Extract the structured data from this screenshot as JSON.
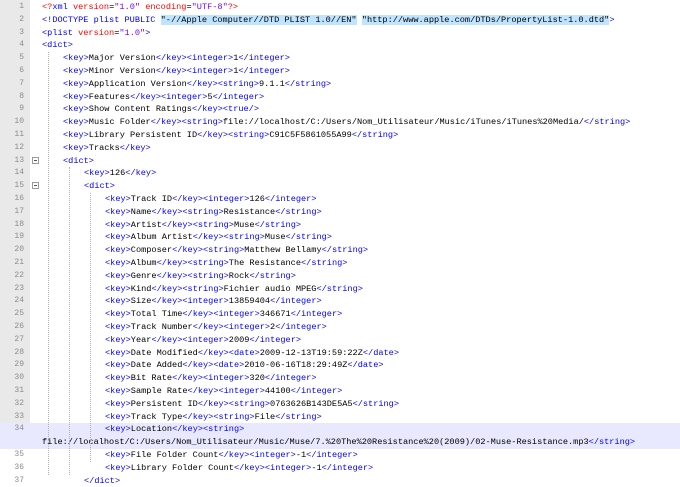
{
  "editor": {
    "lines": [
      {
        "n": "1",
        "parts": [
          [
            "pi",
            "<?"
          ],
          [
            "t",
            "xml"
          ],
          [
            "a",
            " version"
          ],
          [
            "x",
            "="
          ],
          [
            "v",
            "\"1.0\""
          ],
          [
            "a",
            " encoding"
          ],
          [
            "x",
            "="
          ],
          [
            "v",
            "\"UTF-8\""
          ],
          [
            "pi",
            "?>"
          ]
        ],
        "indent": 0
      },
      {
        "n": "2",
        "parts": [
          [
            "t",
            "<!DOCTYPE plist PUBLIC "
          ],
          [
            "hl",
            "\"-//Apple Computer//DTD PLIST 1.0//EN\""
          ],
          [
            "x",
            " "
          ],
          [
            "hl",
            "\"http://www.apple.com/DTDs/PropertyList-1.0.dtd\""
          ],
          [
            "t",
            ">"
          ]
        ],
        "indent": 0
      },
      {
        "n": "3",
        "parts": [
          [
            "t",
            "<plist"
          ],
          [
            "a",
            " version"
          ],
          [
            "x",
            "="
          ],
          [
            "v",
            "\"1.0\""
          ],
          [
            "t",
            ">"
          ]
        ],
        "indent": 0
      },
      {
        "n": "4",
        "parts": [
          [
            "t",
            "<dict>"
          ]
        ],
        "indent": 0
      },
      {
        "n": "5",
        "parts": [
          [
            "t",
            "<key>"
          ],
          [
            "x",
            "Major Version"
          ],
          [
            "t",
            "</key><integer>"
          ],
          [
            "x",
            "1"
          ],
          [
            "t",
            "</integer>"
          ]
        ],
        "indent": 1
      },
      {
        "n": "6",
        "parts": [
          [
            "t",
            "<key>"
          ],
          [
            "x",
            "Minor Version"
          ],
          [
            "t",
            "</key><integer>"
          ],
          [
            "x",
            "1"
          ],
          [
            "t",
            "</integer>"
          ]
        ],
        "indent": 1
      },
      {
        "n": "7",
        "parts": [
          [
            "t",
            "<key>"
          ],
          [
            "x",
            "Application Version"
          ],
          [
            "t",
            "</key><string>"
          ],
          [
            "x",
            "9.1.1"
          ],
          [
            "t",
            "</string>"
          ]
        ],
        "indent": 1
      },
      {
        "n": "8",
        "parts": [
          [
            "t",
            "<key>"
          ],
          [
            "x",
            "Features"
          ],
          [
            "t",
            "</key><integer>"
          ],
          [
            "x",
            "5"
          ],
          [
            "t",
            "</integer>"
          ]
        ],
        "indent": 1
      },
      {
        "n": "9",
        "parts": [
          [
            "t",
            "<key>"
          ],
          [
            "x",
            "Show Content Ratings"
          ],
          [
            "t",
            "</key><true/>"
          ]
        ],
        "indent": 1
      },
      {
        "n": "10",
        "parts": [
          [
            "t",
            "<key>"
          ],
          [
            "x",
            "Music Folder"
          ],
          [
            "t",
            "</key><string>"
          ],
          [
            "x",
            "file://localhost/C:/Users/Nom_Utilisateur/Music/iTunes/iTunes%20Media/"
          ],
          [
            "t",
            "</string>"
          ]
        ],
        "indent": 1
      },
      {
        "n": "11",
        "parts": [
          [
            "t",
            "<key>"
          ],
          [
            "x",
            "Library Persistent ID"
          ],
          [
            "t",
            "</key><string>"
          ],
          [
            "x",
            "C91C5F5861055A99"
          ],
          [
            "t",
            "</string>"
          ]
        ],
        "indent": 1
      },
      {
        "n": "12",
        "parts": [
          [
            "t",
            "<key>"
          ],
          [
            "x",
            "Tracks"
          ],
          [
            "t",
            "</key>"
          ]
        ],
        "indent": 1
      },
      {
        "n": "13",
        "parts": [
          [
            "t",
            "<dict>"
          ]
        ],
        "indent": 1,
        "fold": true
      },
      {
        "n": "14",
        "parts": [
          [
            "t",
            "<key>"
          ],
          [
            "x",
            "126"
          ],
          [
            "t",
            "</key>"
          ]
        ],
        "indent": 2
      },
      {
        "n": "15",
        "parts": [
          [
            "t",
            "<dict>"
          ]
        ],
        "indent": 2,
        "fold": true
      },
      {
        "n": "16",
        "parts": [
          [
            "t",
            "<key>"
          ],
          [
            "x",
            "Track ID"
          ],
          [
            "t",
            "</key><integer>"
          ],
          [
            "x",
            "126"
          ],
          [
            "t",
            "</integer>"
          ]
        ],
        "indent": 3
      },
      {
        "n": "17",
        "parts": [
          [
            "t",
            "<key>"
          ],
          [
            "x",
            "Name"
          ],
          [
            "t",
            "</key><string>"
          ],
          [
            "x",
            "Resistance"
          ],
          [
            "t",
            "</string>"
          ]
        ],
        "indent": 3
      },
      {
        "n": "18",
        "parts": [
          [
            "t",
            "<key>"
          ],
          [
            "x",
            "Artist"
          ],
          [
            "t",
            "</key><string>"
          ],
          [
            "x",
            "Muse"
          ],
          [
            "t",
            "</string>"
          ]
        ],
        "indent": 3
      },
      {
        "n": "19",
        "parts": [
          [
            "t",
            "<key>"
          ],
          [
            "x",
            "Album Artist"
          ],
          [
            "t",
            "</key><string>"
          ],
          [
            "x",
            "Muse"
          ],
          [
            "t",
            "</string>"
          ]
        ],
        "indent": 3
      },
      {
        "n": "20",
        "parts": [
          [
            "t",
            "<key>"
          ],
          [
            "x",
            "Composer"
          ],
          [
            "t",
            "</key><string>"
          ],
          [
            "x",
            "Matthew Bellamy"
          ],
          [
            "t",
            "</string>"
          ]
        ],
        "indent": 3
      },
      {
        "n": "21",
        "parts": [
          [
            "t",
            "<key>"
          ],
          [
            "x",
            "Album"
          ],
          [
            "t",
            "</key><string>"
          ],
          [
            "x",
            "The Resistance"
          ],
          [
            "t",
            "</string>"
          ]
        ],
        "indent": 3
      },
      {
        "n": "22",
        "parts": [
          [
            "t",
            "<key>"
          ],
          [
            "x",
            "Genre"
          ],
          [
            "t",
            "</key><string>"
          ],
          [
            "x",
            "Rock"
          ],
          [
            "t",
            "</string>"
          ]
        ],
        "indent": 3
      },
      {
        "n": "23",
        "parts": [
          [
            "t",
            "<key>"
          ],
          [
            "x",
            "Kind"
          ],
          [
            "t",
            "</key><string>"
          ],
          [
            "x",
            "Fichier audio MPEG"
          ],
          [
            "t",
            "</string>"
          ]
        ],
        "indent": 3
      },
      {
        "n": "24",
        "parts": [
          [
            "t",
            "<key>"
          ],
          [
            "x",
            "Size"
          ],
          [
            "t",
            "</key><integer>"
          ],
          [
            "x",
            "13859404"
          ],
          [
            "t",
            "</integer>"
          ]
        ],
        "indent": 3
      },
      {
        "n": "25",
        "parts": [
          [
            "t",
            "<key>"
          ],
          [
            "x",
            "Total Time"
          ],
          [
            "t",
            "</key><integer>"
          ],
          [
            "x",
            "346671"
          ],
          [
            "t",
            "</integer>"
          ]
        ],
        "indent": 3
      },
      {
        "n": "26",
        "parts": [
          [
            "t",
            "<key>"
          ],
          [
            "x",
            "Track Number"
          ],
          [
            "t",
            "</key><integer>"
          ],
          [
            "x",
            "2"
          ],
          [
            "t",
            "</integer>"
          ]
        ],
        "indent": 3
      },
      {
        "n": "27",
        "parts": [
          [
            "t",
            "<key>"
          ],
          [
            "x",
            "Year"
          ],
          [
            "t",
            "</key><integer>"
          ],
          [
            "x",
            "2009"
          ],
          [
            "t",
            "</integer>"
          ]
        ],
        "indent": 3
      },
      {
        "n": "28",
        "parts": [
          [
            "t",
            "<key>"
          ],
          [
            "x",
            "Date Modified"
          ],
          [
            "t",
            "</key><date>"
          ],
          [
            "x",
            "2009-12-13T19:59:22Z"
          ],
          [
            "t",
            "</date>"
          ]
        ],
        "indent": 3
      },
      {
        "n": "29",
        "parts": [
          [
            "t",
            "<key>"
          ],
          [
            "x",
            "Date Added"
          ],
          [
            "t",
            "</key><date>"
          ],
          [
            "x",
            "2010-06-16T18:29:49Z"
          ],
          [
            "t",
            "</date>"
          ]
        ],
        "indent": 3
      },
      {
        "n": "30",
        "parts": [
          [
            "t",
            "<key>"
          ],
          [
            "x",
            "Bit Rate"
          ],
          [
            "t",
            "</key><integer>"
          ],
          [
            "x",
            "320"
          ],
          [
            "t",
            "</integer>"
          ]
        ],
        "indent": 3
      },
      {
        "n": "31",
        "parts": [
          [
            "t",
            "<key>"
          ],
          [
            "x",
            "Sample Rate"
          ],
          [
            "t",
            "</key><integer>"
          ],
          [
            "x",
            "44100"
          ],
          [
            "t",
            "</integer>"
          ]
        ],
        "indent": 3
      },
      {
        "n": "32",
        "parts": [
          [
            "t",
            "<key>"
          ],
          [
            "x",
            "Persistent ID"
          ],
          [
            "t",
            "</key><string>"
          ],
          [
            "x",
            "0763626B143DE5A5"
          ],
          [
            "t",
            "</string>"
          ]
        ],
        "indent": 3
      },
      {
        "n": "33",
        "parts": [
          [
            "t",
            "<key>"
          ],
          [
            "x",
            "Track Type"
          ],
          [
            "t",
            "</key><string>"
          ],
          [
            "x",
            "File"
          ],
          [
            "t",
            "</string>"
          ]
        ],
        "indent": 3
      },
      {
        "n": "34",
        "parts": [
          [
            "t",
            "<key>"
          ],
          [
            "x",
            "Location"
          ],
          [
            "t",
            "</key><string>"
          ]
        ],
        "indent": 3,
        "current": true
      },
      {
        "n": "",
        "parts": [
          [
            "x",
            "file://localhost/C:/Users/Nom_Utilisateur/Music/Muse/7.%20The%20Resistance%20(2009)/02-Muse-Resistance.mp3"
          ],
          [
            "t",
            "</string>"
          ]
        ],
        "indent": -1,
        "current": true
      },
      {
        "n": "35",
        "parts": [
          [
            "t",
            "<key>"
          ],
          [
            "x",
            "File Folder Count"
          ],
          [
            "t",
            "</key><integer>"
          ],
          [
            "x",
            "-1"
          ],
          [
            "t",
            "</integer>"
          ]
        ],
        "indent": 3
      },
      {
        "n": "36",
        "parts": [
          [
            "t",
            "<key>"
          ],
          [
            "x",
            "Library Folder Count"
          ],
          [
            "t",
            "</key><integer>"
          ],
          [
            "x",
            "-1"
          ],
          [
            "t",
            "</integer>"
          ]
        ],
        "indent": 3
      },
      {
        "n": "37",
        "parts": [
          [
            "t",
            "</dict>"
          ]
        ],
        "indent": 2
      }
    ]
  },
  "colors": {
    "tag": "#0000ff",
    "attribute": "#ff0000",
    "attr_value": "#8000ff",
    "text": "#000000",
    "gutter_bg": "#e9e9e9",
    "current_line": "#e8e8ff",
    "doctype_highlight": "#bfe4ff"
  }
}
